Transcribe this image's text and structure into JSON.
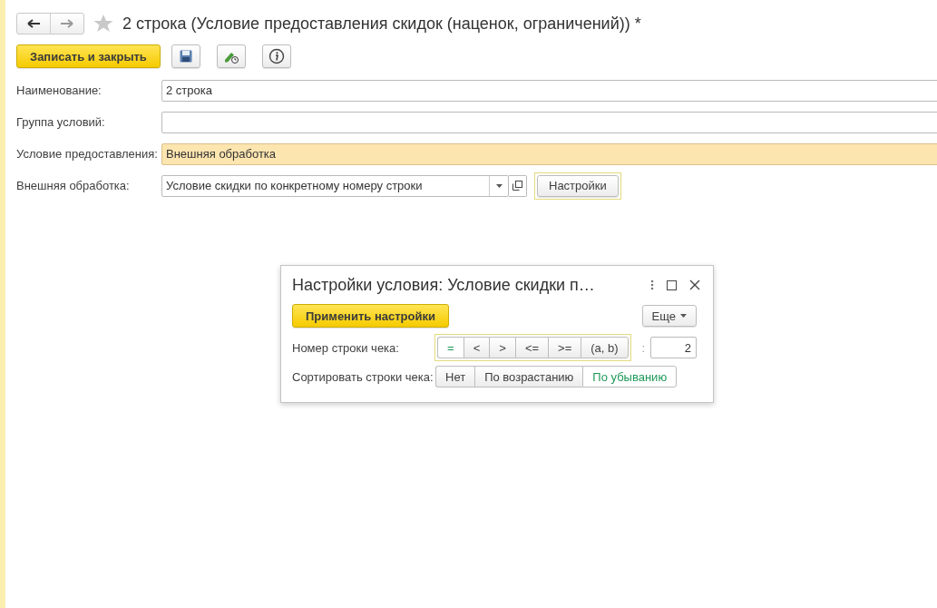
{
  "window": {
    "title": "2 строка (Условие предоставления скидок (наценок, ограничений)) *",
    "favorite": false
  },
  "toolbar": {
    "primary_button": "Записать и закрыть"
  },
  "fields": [
    {
      "label": "Наименование:",
      "value": "2 строка",
      "kind": "text",
      "highlighted": false
    },
    {
      "label": "Группа условий:",
      "kind": "text",
      "highlighted": false
    },
    {
      "label": "Условие предоставления:",
      "value": "Внешняя обработка",
      "kind": "text",
      "highlighted": true
    },
    {
      "label": "Внешняя обработка:",
      "value": "Условие скидки по конкретному номеру строки",
      "kind": "select",
      "highlighted": false,
      "button": "Настройки"
    }
  ],
  "dialog": {
    "title": "Настройки условия: Условие скидки п…",
    "apply_button": "Применить настройки",
    "more_button": "Еще",
    "rows": [
      {
        "label": "Номер строки чека:",
        "options": [
          {
            "label": "=",
            "selected": true
          },
          {
            "label": "<",
            "selected": false
          },
          {
            "label": ">",
            "selected": false
          },
          {
            "label": "<=",
            "selected": false
          },
          {
            "label": ">=",
            "selected": false
          },
          {
            "label": "(a, b)",
            "selected": false
          }
        ],
        "separator": ":",
        "value": "2"
      },
      {
        "label": "Сортировать строки чека:",
        "options": [
          {
            "label": "Нет",
            "selected": false
          },
          {
            "label": "По возрастанию",
            "selected": false
          },
          {
            "label": "По убыванию",
            "selected": true
          }
        ]
      }
    ]
  }
}
